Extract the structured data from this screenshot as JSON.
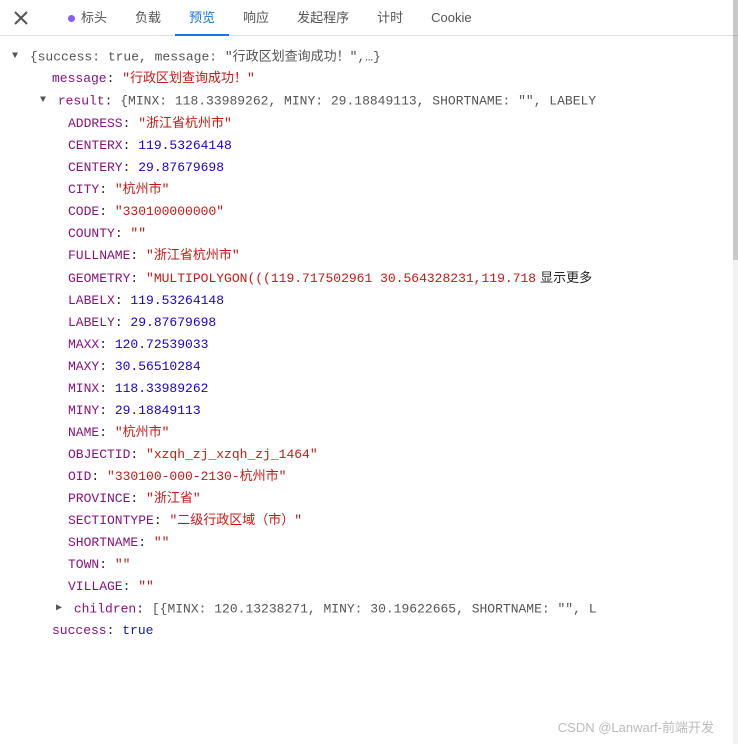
{
  "tabs": {
    "headers": "标头",
    "payload": "负载",
    "preview": "预览",
    "response": "响应",
    "initiator": "发起程序",
    "timing": "计时",
    "cookies": "Cookie"
  },
  "summary": "{success: true, message: \"行政区划查询成功！\",…}",
  "message_key": "message",
  "message_val": "\"行政区划查询成功！\"",
  "result_key": "result",
  "result_summary": "{MINX: 118.33989262, MINY: 29.18849113, SHORTNAME: \"\", LABELY",
  "fields": {
    "ADDRESS": {
      "k": "ADDRESS",
      "v": "\"浙江省杭州市\"",
      "t": "str"
    },
    "CENTERX": {
      "k": "CENTERX",
      "v": "119.53264148",
      "t": "num"
    },
    "CENTERY": {
      "k": "CENTERY",
      "v": "29.87679698",
      "t": "num"
    },
    "CITY": {
      "k": "CITY",
      "v": "\"杭州市\"",
      "t": "str"
    },
    "CODE": {
      "k": "CODE",
      "v": "\"330100000000\"",
      "t": "str"
    },
    "COUNTY": {
      "k": "COUNTY",
      "v": "\"\"",
      "t": "str"
    },
    "FULLNAME": {
      "k": "FULLNAME",
      "v": "\"浙江省杭州市\"",
      "t": "str"
    },
    "GEOMETRY": {
      "k": "GEOMETRY",
      "v": "\"MULTIPOLYGON(((119.717502961 30.564328231,119.718",
      "t": "str"
    },
    "LABELX": {
      "k": "LABELX",
      "v": "119.53264148",
      "t": "num"
    },
    "LABELY": {
      "k": "LABELY",
      "v": "29.87679698",
      "t": "num"
    },
    "MAXX": {
      "k": "MAXX",
      "v": "120.72539033",
      "t": "num"
    },
    "MAXY": {
      "k": "MAXY",
      "v": "30.56510284",
      "t": "num"
    },
    "MINX": {
      "k": "MINX",
      "v": "118.33989262",
      "t": "num"
    },
    "MINY": {
      "k": "MINY",
      "v": "29.18849113",
      "t": "num"
    },
    "NAME": {
      "k": "NAME",
      "v": "\"杭州市\"",
      "t": "str"
    },
    "OBJECTID": {
      "k": "OBJECTID",
      "v": "\"xzqh_zj_xzqh_zj_1464\"",
      "t": "str"
    },
    "OID": {
      "k": "OID",
      "v": "\"330100-000-2130-杭州市\"",
      "t": "str"
    },
    "PROVINCE": {
      "k": "PROVINCE",
      "v": "\"浙江省\"",
      "t": "str"
    },
    "SECTIONTYPE": {
      "k": "SECTIONTYPE",
      "v": "\"二级行政区域（市）\"",
      "t": "str"
    },
    "SHORTNAME": {
      "k": "SHORTNAME",
      "v": "\"\"",
      "t": "str"
    },
    "TOWN": {
      "k": "TOWN",
      "v": "\"\"",
      "t": "str"
    },
    "VILLAGE": {
      "k": "VILLAGE",
      "v": "\"\"",
      "t": "str"
    }
  },
  "children_key": "children",
  "children_summary": "[{MINX: 120.13238271, MINY: 30.19622665, SHORTNAME: \"\", L",
  "success_key": "success",
  "success_val": "true",
  "show_more": "显示更多",
  "watermark": "CSDN @Lanwarf-前端开发"
}
